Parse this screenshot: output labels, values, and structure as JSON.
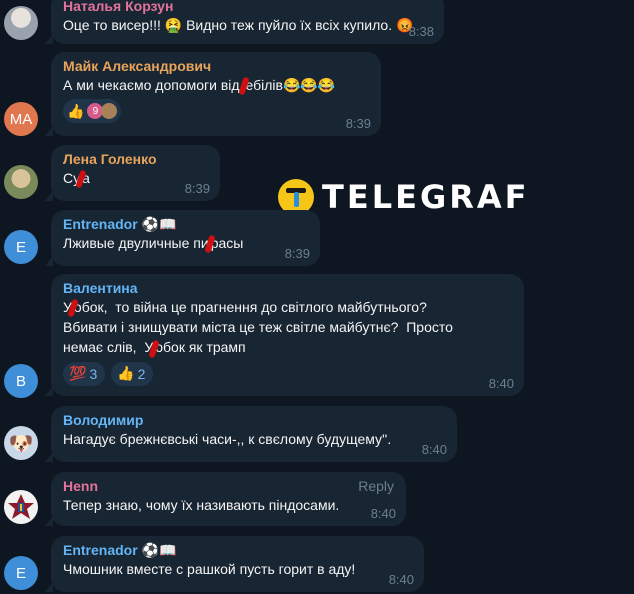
{
  "watermark": {
    "text": "TELEGRAF"
  },
  "messages": [
    {
      "sender": "Наталья Корзун",
      "sender_color": "#e2749a",
      "text": "Оце то висер!!! 🤮 Видно теж пуйло їх всіх купило. 😡",
      "time": "8:38",
      "avatar": {
        "type": "photo",
        "colors": [
          "#9aa3ad",
          "#e8e2dc"
        ]
      }
    },
    {
      "sender": "Майк Александрович",
      "sender_color": "#e8a45a",
      "text_before": "А ми чекаємо допомоги від ",
      "text_after": "ебілів😂😂😂",
      "time": "8:39",
      "avatar": {
        "type": "initials",
        "initials": "MA",
        "color": "#e0774f"
      },
      "reactions": [
        {
          "emoji": "👍",
          "count": ""
        },
        {
          "emoji": "9",
          "count": ""
        }
      ]
    },
    {
      "sender": "Лена Голенко",
      "sender_color": "#e8a45a",
      "text_before": "Су",
      "text_after": "а",
      "time": "8:39",
      "avatar": {
        "type": "photo",
        "colors": [
          "#7a8a5a",
          "#d9c39a"
        ]
      }
    },
    {
      "sender": "Entrenador ⚽️📖",
      "sender_color": "#64b5f6",
      "text_before": "Лживые двуличные пи",
      "text_after": "расы",
      "time": "8:39",
      "avatar": {
        "type": "initials",
        "initials": "E",
        "color": "#3f8fd8"
      }
    },
    {
      "sender": "Валентина",
      "sender_color": "#64b5f6",
      "line1_before": "У",
      "line1_after": "обок,  то війна це прагнення до світлого майбутнього?",
      "line2": "Вбивати і знищувати міста це теж світле майбутнє?  Просто",
      "line3_before": "немає слів,  У",
      "line3_after": "обок як трамп",
      "time": "8:40",
      "avatar": {
        "type": "initials",
        "initials": "B",
        "color": "#3f8fd8"
      },
      "reactions": [
        {
          "emoji": "💯",
          "count": "3"
        },
        {
          "emoji": "👍",
          "count": "2"
        }
      ]
    },
    {
      "sender": "Володимир",
      "sender_color": "#64b5f6",
      "text": "Нагадує брежнєвські часи-,, к свєлому будущему''.",
      "time": "8:40",
      "avatar": {
        "type": "emoji",
        "emoji": "🐶",
        "color": "#c8d8e8"
      }
    },
    {
      "sender": "Henn",
      "sender_color": "#e2749a",
      "text": "Тепер знаю, чому їх називають піндосами.",
      "time": "8:40",
      "reply_label": "Reply",
      "avatar": {
        "type": "emblem",
        "color": "#f2f2f2"
      }
    },
    {
      "sender": "Entrenador ⚽️📖",
      "sender_color": "#64b5f6",
      "text": "Чмошник вместе с рашкой пусть горит в аду!",
      "time": "8:40",
      "avatar": {
        "type": "initials",
        "initials": "E",
        "color": "#3f8fd8"
      }
    }
  ]
}
